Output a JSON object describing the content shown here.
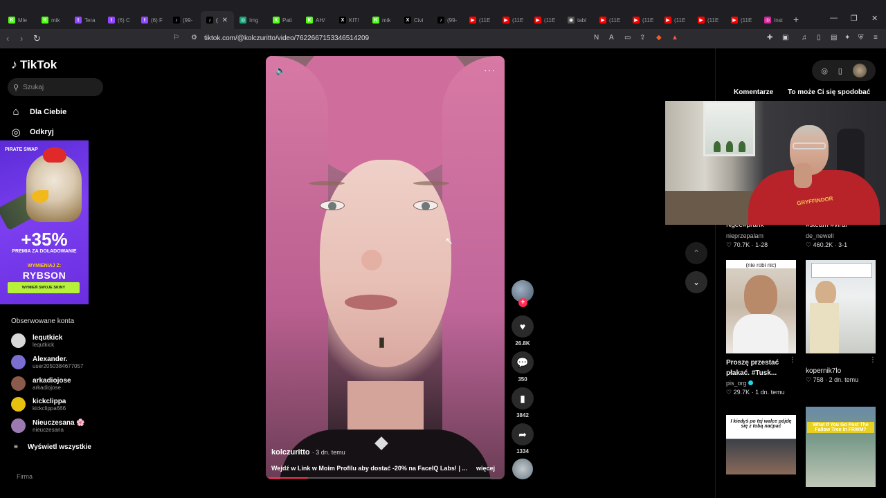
{
  "browser": {
    "tabs": [
      {
        "label": "Mle",
        "color": "#53fc18",
        "glyph": "K"
      },
      {
        "label": "mik",
        "color": "#53fc18",
        "glyph": "K"
      },
      {
        "label": "Tera",
        "color": "#9146ff",
        "glyph": "t"
      },
      {
        "label": "(6) C",
        "color": "#9146ff",
        "glyph": "t"
      },
      {
        "label": "(6) F",
        "color": "#9146ff",
        "glyph": "t"
      },
      {
        "label": "(99-",
        "color": "#000000",
        "glyph": "♪"
      },
      {
        "label": "(",
        "color": "#000000",
        "glyph": "♪"
      },
      {
        "label": "Img",
        "color": "#1aa37a",
        "glyph": "◎"
      },
      {
        "label": "Pati",
        "color": "#53fc18",
        "glyph": "K"
      },
      {
        "label": "AH/",
        "color": "#53fc18",
        "glyph": "K"
      },
      {
        "label": "KIT!",
        "color": "#000000",
        "glyph": "X"
      },
      {
        "label": "mik",
        "color": "#53fc18",
        "glyph": "K"
      },
      {
        "label": "Civi",
        "color": "#000000",
        "glyph": "X"
      },
      {
        "label": "(99-",
        "color": "#000000",
        "glyph": "♪"
      },
      {
        "label": "(11E",
        "color": "#ff0000",
        "glyph": "▶"
      },
      {
        "label": "(11E",
        "color": "#ff0000",
        "glyph": "▶"
      },
      {
        "label": "(11E",
        "color": "#ff0000",
        "glyph": "▶"
      },
      {
        "label": "tabl",
        "color": "#555555",
        "glyph": "◉"
      },
      {
        "label": "(11E",
        "color": "#ff0000",
        "glyph": "▶"
      },
      {
        "label": "(11E",
        "color": "#ff0000",
        "glyph": "▶"
      },
      {
        "label": "(11E",
        "color": "#ff0000",
        "glyph": "▶"
      },
      {
        "label": "(11E",
        "color": "#ff0000",
        "glyph": "▶"
      },
      {
        "label": "(11E",
        "color": "#ff0000",
        "glyph": "▶"
      },
      {
        "label": "Inst",
        "color": "#d6249f",
        "glyph": "◎"
      }
    ],
    "active_tab_index": 6,
    "url": "tiktok.com/@kolczuritto/video/7622667153346514209"
  },
  "tiktok": {
    "brand": "TikTok",
    "search_placeholder": "Szukaj",
    "nav": [
      {
        "label": "Dla Ciebie",
        "icon": "home-icon"
      },
      {
        "label": "Odkryj",
        "icon": "compass-icon"
      }
    ],
    "ad": {
      "brand": "PIRATE SWAP",
      "headline": "+35%",
      "subline": "PREMIA ZA DOŁADOWANIE",
      "exchange_label": "WYMIENIAJ Z:",
      "partner": "RYBSON",
      "cta": "WYMIEŃ SWOJE SKINY",
      "bg_color": "#6a2ee0",
      "cta_color": "#b6f23a"
    },
    "following_title": "Obserwowane konta",
    "following": [
      {
        "name": "lequtkick",
        "handle": "lequtkick",
        "avatar_color": "#d8d8d8"
      },
      {
        "name": "Alexander.",
        "handle": "user2050384677057",
        "avatar_color": "#7a6fd0"
      },
      {
        "name": "arkadiojose",
        "handle": "arkadiojose",
        "avatar_color": "#8a5a4a"
      },
      {
        "name": "kickclippa",
        "handle": "kickclippa666",
        "avatar_color": "#e8c010"
      },
      {
        "name": "Nieuczesana 🌸",
        "handle": "nieuczesana",
        "avatar_color": "#9a7ab0"
      }
    ],
    "show_all": "Wyświetl wszystkie",
    "footer_firma": "Firma"
  },
  "video": {
    "author": "kolczuritto",
    "posted": "· 3 dn. temu",
    "description": "Wejdź w Link w Moim Profilu aby dostać -20% na FaceIQ Labs! | ...",
    "more": "więcej",
    "progress_fraction": 0.17,
    "likes": "26.8K",
    "comments": "350",
    "saves": "3842",
    "shares": "1334"
  },
  "right_panel": {
    "tabs": [
      "Komentarze",
      "To może Ci się spodobać"
    ],
    "items": [
      {
        "caption": "Ngee#prank",
        "author": "nieprzepalam",
        "stats": "♡ 70.7K · 1-28"
      },
      {
        "caption": "#steam #viral",
        "author": "de_newell",
        "stats": "♡ 460.2K · 3-1"
      },
      {
        "overlay": "(nie robi nic)",
        "caption": "Proszę przestać płakać. #Tusk...",
        "author": "pis_org",
        "stats": "♡ 29.7K · 1 dn. temu"
      },
      {
        "caption": "kopernik7lo",
        "author": "",
        "stats": "♡ 758 · 2 dn. temu"
      },
      {
        "overlay": "I kiedyś po tej walce pójdę się z tobą naćpać",
        "caption": "",
        "author": "",
        "stats": ""
      },
      {
        "overlay": "What If You Go Past The Fallow Tree in FRWM?",
        "caption": "",
        "author": "",
        "stats": ""
      }
    ]
  },
  "webcam": {
    "hoodie_text": "GRYFFINDOR"
  }
}
